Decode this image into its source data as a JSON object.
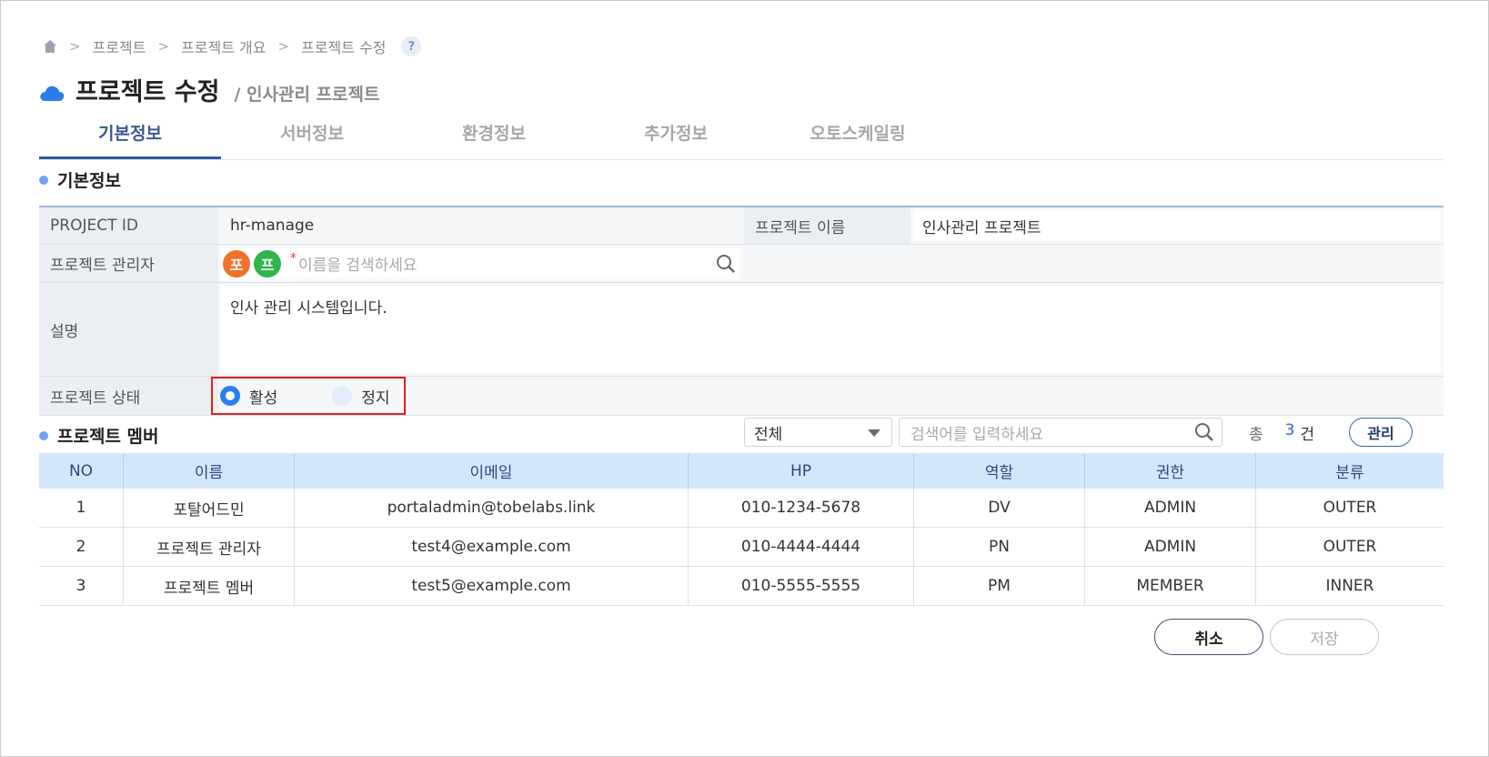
{
  "breadcrumb": {
    "items": [
      "프로젝트",
      "프로젝트 개요",
      "프로젝트 수정"
    ],
    "separator": ">",
    "help": "?"
  },
  "header": {
    "title": "프로젝트 수정",
    "subtitle": "/ 인사관리 프로젝트"
  },
  "tabs": [
    {
      "label": "기본정보",
      "active": true
    },
    {
      "label": "서버정보",
      "active": false
    },
    {
      "label": "환경정보",
      "active": false
    },
    {
      "label": "추가정보",
      "active": false
    },
    {
      "label": "오토스케일링",
      "active": false
    }
  ],
  "basic": {
    "section_title": "기본정보",
    "project_id_label": "PROJECT ID",
    "project_id_value": "hr-manage",
    "project_name_label": "프로젝트 이름",
    "project_name_value": "인사관리 프로젝트",
    "manager_label": "프로젝트 관리자",
    "manager_avatars": [
      "포",
      "프"
    ],
    "manager_required": "*",
    "manager_placeholder": "이름을 검색하세요",
    "description_label": "설명",
    "description_value": "인사 관리 시스템입니다.",
    "status_label": "프로젝트 상태",
    "status_options": [
      {
        "label": "활성",
        "selected": true
      },
      {
        "label": "정지",
        "selected": false
      }
    ]
  },
  "members": {
    "section_title": "프로젝트 멤버",
    "filter_value": "전체",
    "search_placeholder": "검색어를 입력하세요",
    "total_label": "총",
    "total_count": "3",
    "total_unit": "건",
    "manage_label": "관리",
    "columns": [
      "NO",
      "이름",
      "이메일",
      "HP",
      "역할",
      "권한",
      "분류"
    ],
    "rows": [
      [
        "1",
        "포탈어드민",
        "portaladmin@tobelabs.link",
        "010-1234-5678",
        "DV",
        "ADMIN",
        "OUTER"
      ],
      [
        "2",
        "프로젝트 관리자",
        "test4@example.com",
        "010-4444-4444",
        "PN",
        "ADMIN",
        "OUTER"
      ],
      [
        "3",
        "프로젝트 멤버",
        "test5@example.com",
        "010-5555-5555",
        "PM",
        "MEMBER",
        "INNER"
      ]
    ]
  },
  "footer": {
    "cancel_label": "취소",
    "save_label": "저장"
  },
  "colors": {
    "accent": "#2a7ff0",
    "tab_active": "#2d5a9e",
    "table_header_bg": "#d4e6fb",
    "highlight_border": "#e02020",
    "avatar_orange": "#f07128",
    "avatar_green": "#2fb54a"
  },
  "icons": [
    "home-icon",
    "help-icon",
    "cloud-icon",
    "search-icon",
    "chevron-down-icon"
  ]
}
